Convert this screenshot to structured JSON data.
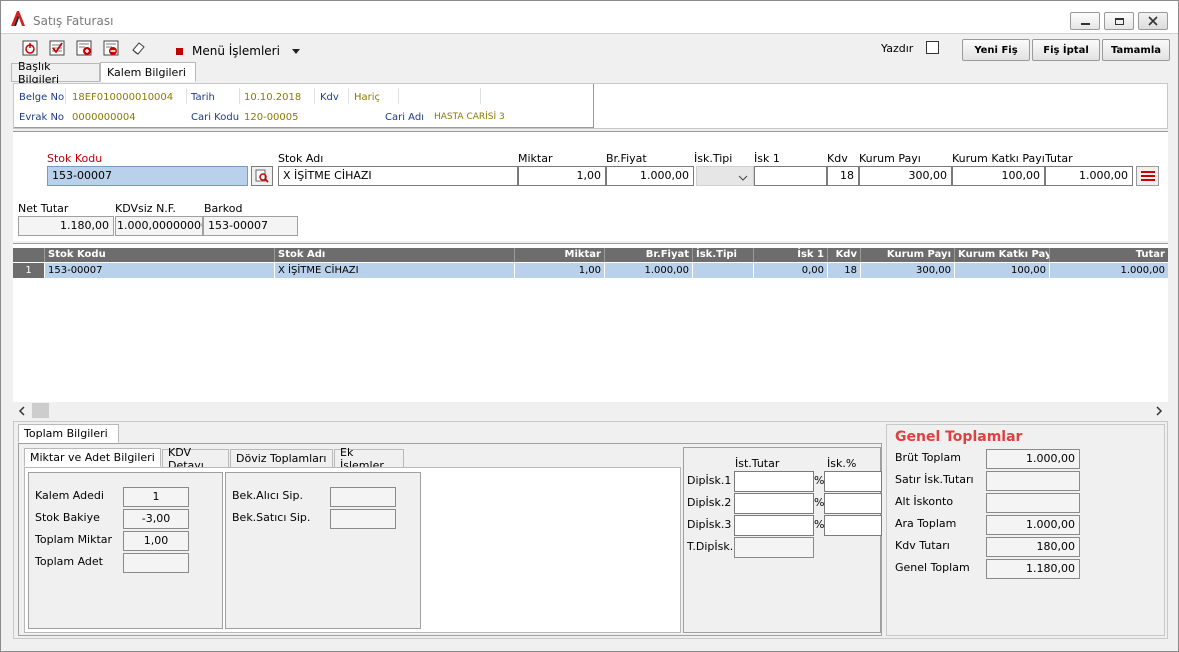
{
  "window": {
    "title": "Satış Faturası"
  },
  "toolbar": {
    "menu_label": "Menü İşlemleri",
    "print_label": "Yazdır",
    "new_label": "Yeni Fiş",
    "cancel_label": "Fiş İptal",
    "complete_label": "Tamamla"
  },
  "tabs": {
    "header": "Başlık Bilgileri",
    "items": "Kalem Bilgileri"
  },
  "header": {
    "belge_no_label": "Belge No",
    "belge_no": "18EF010000010004",
    "tarih_label": "Tarih",
    "tarih": "10.10.2018",
    "kdv_label": "Kdv",
    "kdv": "Hariç",
    "evrak_no_label": "Evrak No",
    "evrak_no": "0000000004",
    "cari_kodu_label": "Cari Kodu",
    "cari_kodu": "120-00005",
    "cari_adi_label": "Cari Adı",
    "cari_adi": "HASTA CARİSİ 3"
  },
  "entry": {
    "stok_kodu_label": "Stok Kodu",
    "stok_kodu": "153-00007",
    "stok_adi_label": "Stok Adı",
    "stok_adi": "X İŞİTME CİHAZI",
    "miktar_label": "Miktar",
    "miktar": "1,00",
    "br_fiyat_label": "Br.Fiyat",
    "br_fiyat": "1.000,00",
    "isk_tipi_label": "İsk.Tipi",
    "isk1_label": "İsk 1",
    "isk1": "",
    "kdv_label": "Kdv",
    "kdv": "18",
    "kurum_payi_label": "Kurum Payı",
    "kurum_payi": "300,00",
    "kurum_katki_label": "Kurum Katkı Payı",
    "kurum_katki": "100,00",
    "tutar_label": "Tutar",
    "tutar": "1.000,00",
    "net_tutar_label": "Net Tutar",
    "net_tutar": "1.180,00",
    "kdvsiz_label": "KDVsiz N.F.",
    "kdvsiz": "1.000,00000000",
    "barkod_label": "Barkod",
    "barkod": "153-00007"
  },
  "grid": {
    "columns": [
      "Stok Kodu",
      "Stok Adı",
      "Miktar",
      "Br.Fiyat",
      "İsk.Tipi",
      "İsk 1",
      "Kdv",
      "Kurum Payı",
      "Kurum Katkı Payı",
      "Tutar"
    ],
    "rows": [
      {
        "num": "1",
        "stok_kodu": "153-00007",
        "stok_adi": "X İŞİTME CİHAZI",
        "miktar": "1,00",
        "br_fiyat": "1.000,00",
        "isk_tipi": "",
        "isk1": "0,00",
        "kdv": "18",
        "kurum_payi": "300,00",
        "kurum_katki": "100,00",
        "tutar": "1.000,00"
      }
    ]
  },
  "bottom": {
    "tab_toplam": "Toplam Bilgileri",
    "subtabs": [
      "Miktar ve Adet Bilgileri",
      "KDV Detayı",
      "Döviz Toplamları",
      "Ek İşlemler"
    ],
    "kalem_adedi_label": "Kalem Adedi",
    "kalem_adedi": "1",
    "stok_bakiye_label": "Stok Bakiye",
    "stok_bakiye": "-3,00",
    "toplam_miktar_label": "Toplam Miktar",
    "toplam_miktar": "1,00",
    "toplam_adet_label": "Toplam Adet",
    "toplam_adet": "",
    "bek_alici_label": "Bek.Alıcı Sip.",
    "bek_satici_label": "Bek.Satıcı Sip.",
    "ist_tutar_label": "İst.Tutar",
    "isk_pct_label": "İsk.%",
    "dipisk1_label": "Dipİsk.1",
    "dipisk2_label": "Dipİsk.2",
    "dipisk3_label": "Dipİsk.3",
    "tdipisk_label": "T.Dipİsk.",
    "pct": "%"
  },
  "totals": {
    "title": "Genel Toplamlar",
    "brut_label": "Brüt Toplam",
    "brut": "1.000,00",
    "satir_isk_label": "Satır İsk.Tutarı",
    "satir_isk": "",
    "alt_isk_label": "Alt İskonto",
    "alt_isk": "",
    "ara_label": "Ara Toplam",
    "ara": "1.000,00",
    "kdv_tutari_label": "Kdv Tutarı",
    "kdv_tutari": "180,00",
    "genel_label": "Genel Toplam",
    "genel": "1.180,00"
  }
}
